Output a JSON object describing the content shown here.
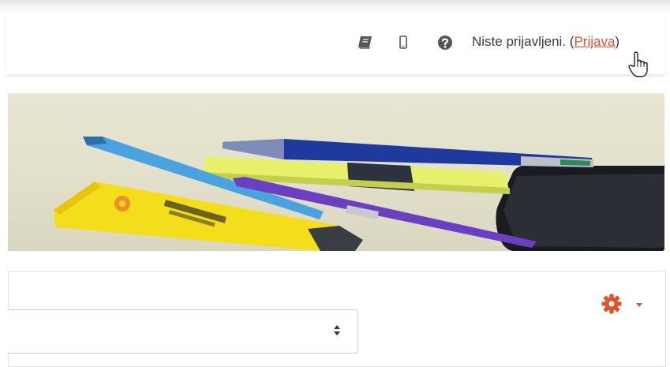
{
  "header": {
    "login_status": "Niste prijavljeni. (",
    "login_link": "Prijava",
    "login_close": ")",
    "icons": [
      "book-icon",
      "mobile-icon",
      "help-icon"
    ]
  },
  "card": {
    "menu_icon": "gear-icon",
    "select_value": ""
  },
  "colors": {
    "accent": "#e0532a",
    "text": "#373a3c",
    "icon": "#555555"
  }
}
